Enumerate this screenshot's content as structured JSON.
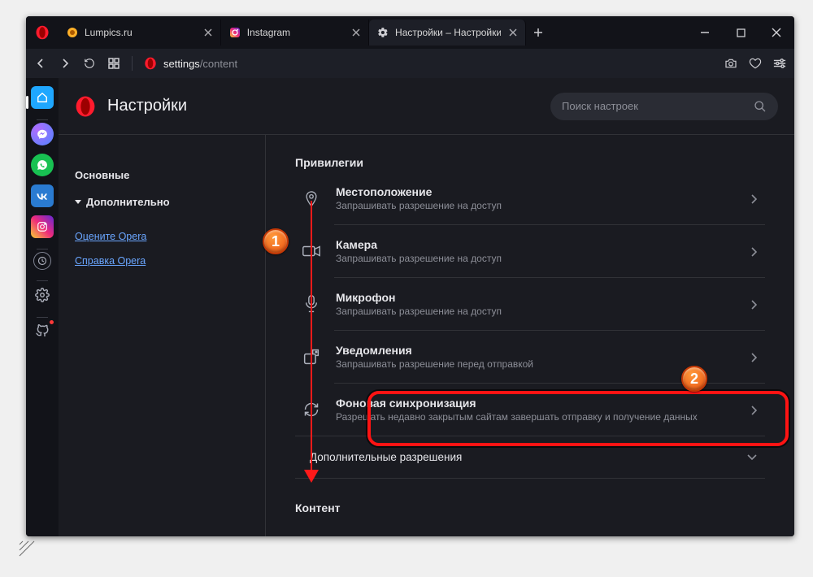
{
  "tabs": [
    {
      "label": "Lumpics.ru"
    },
    {
      "label": "Instagram"
    },
    {
      "label": "Настройки – Настройки с"
    }
  ],
  "addressbar": {
    "segment_muted": "settings",
    "segment_path": "/content"
  },
  "header": {
    "title": "Настройки",
    "search_placeholder": "Поиск настроек"
  },
  "sidenav": {
    "basic": "Основные",
    "advanced": "Дополнительно",
    "rate": "Оцените Opera",
    "help": "Справка Opera"
  },
  "sections": {
    "privileges": "Привилегии",
    "permissions_more": "Дополнительные разрешения",
    "content": "Контент"
  },
  "rows": {
    "location": {
      "title": "Местоположение",
      "sub": "Запрашивать разрешение на доступ"
    },
    "camera": {
      "title": "Камера",
      "sub": "Запрашивать разрешение на доступ"
    },
    "microphone": {
      "title": "Микрофон",
      "sub": "Запрашивать разрешение на доступ"
    },
    "notifications": {
      "title": "Уведомления",
      "sub": "Запрашивать разрешение перед отправкой"
    },
    "bgsync": {
      "title": "Фоновая синхронизация",
      "sub": "Разрешать недавно закрытым сайтам завершать отправку и получение данных"
    }
  },
  "badges": {
    "one": "1",
    "two": "2"
  }
}
